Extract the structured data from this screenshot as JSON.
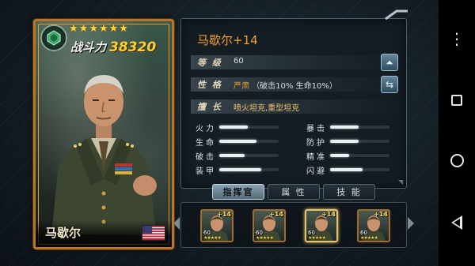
{
  "card": {
    "stars": 6,
    "power_label": "战斗力",
    "power_value": "38320",
    "name": "马歇尔",
    "rank_icon": "green-gem-rank-icon",
    "flag_icon": "us-flag-icon"
  },
  "info": {
    "title": "马歇尔+14",
    "level": {
      "label": "等 级",
      "value": "60"
    },
    "personality": {
      "label": "性 格",
      "value": "严肃",
      "detail": "（破击10% 生命10%）"
    },
    "specialty": {
      "label": "擅 长",
      "value": "喷火坦克,重型坦克"
    },
    "stats": [
      {
        "label": "火力",
        "fill": 0.48
      },
      {
        "label": "暴击",
        "fill": 0.48
      },
      {
        "label": "生命",
        "fill": 0.62
      },
      {
        "label": "防护",
        "fill": 0.48
      },
      {
        "label": "破击",
        "fill": 0.42
      },
      {
        "label": "精准",
        "fill": 0.32
      },
      {
        "label": "装甲",
        "fill": 0.7
      },
      {
        "label": "闪避",
        "fill": 0.55
      }
    ]
  },
  "tabs": [
    {
      "label": "指挥官",
      "active": true
    },
    {
      "label": "属 性",
      "active": false
    },
    {
      "label": "技 能",
      "active": false
    }
  ],
  "roster": [
    {
      "plus": "+14",
      "level": "60",
      "stars": "★★★★★"
    },
    {
      "plus": "+14",
      "level": "60",
      "stars": "★★★★★"
    },
    {
      "plus": "+14",
      "level": "60",
      "stars": "★★★★★"
    },
    {
      "plus": "+14",
      "level": "60",
      "stars": "★★★★★"
    }
  ],
  "colors": {
    "accent": "#f0a030",
    "gold": "#ffcf33",
    "frame": "#b8752a"
  }
}
